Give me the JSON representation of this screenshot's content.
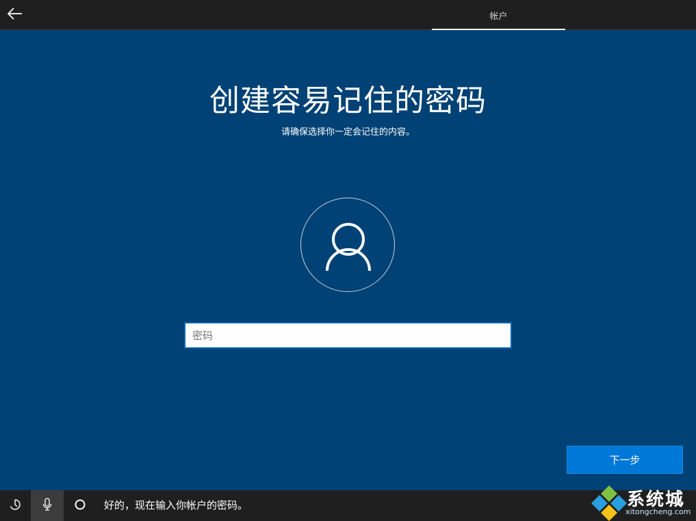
{
  "topbar": {
    "tab_label": "帐户"
  },
  "main": {
    "title": "创建容易记住的密码",
    "subtitle": "请确保选择你一定会记住的内容。",
    "password_placeholder": "密码",
    "password_value": "",
    "next_label": "下一步"
  },
  "bottombar": {
    "cortana_message": "好的，现在输入你帐户的密码。"
  },
  "watermark": {
    "title": "系统城",
    "site": "xitongcheng.com"
  },
  "colors": {
    "background": "#004275",
    "bar": "#1f1f1f",
    "accent": "#0078d7"
  },
  "icons": [
    "back-arrow-icon",
    "user-icon",
    "ease-of-access-icon",
    "microphone-icon",
    "cortana-icon",
    "volume-icon",
    "watermark-logo-icon"
  ]
}
